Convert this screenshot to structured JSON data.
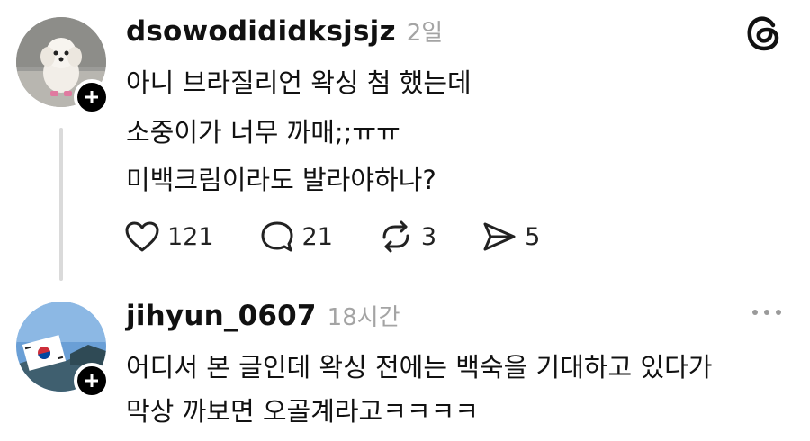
{
  "app": {
    "logo_icon": "threads-logo-icon"
  },
  "posts": [
    {
      "username": "dsowodididksjsjz",
      "time": "2일",
      "lines": [
        "아니 브라질리언 왁싱 첨 했는데",
        "소중이가 너무 까매;;ㅠㅠ",
        "미백크림이라도 발라야하나?"
      ],
      "actions": {
        "likes": "121",
        "replies": "21",
        "reposts": "3",
        "shares": "5"
      }
    },
    {
      "username": "jihyun_0607",
      "time": "18시간",
      "lines": [
        "어디서 본 글인데 왁싱 전에는 백숙을 기대하고 있다가",
        "막상 까보면 오골계라고ㅋㅋㅋㅋ"
      ]
    }
  ]
}
